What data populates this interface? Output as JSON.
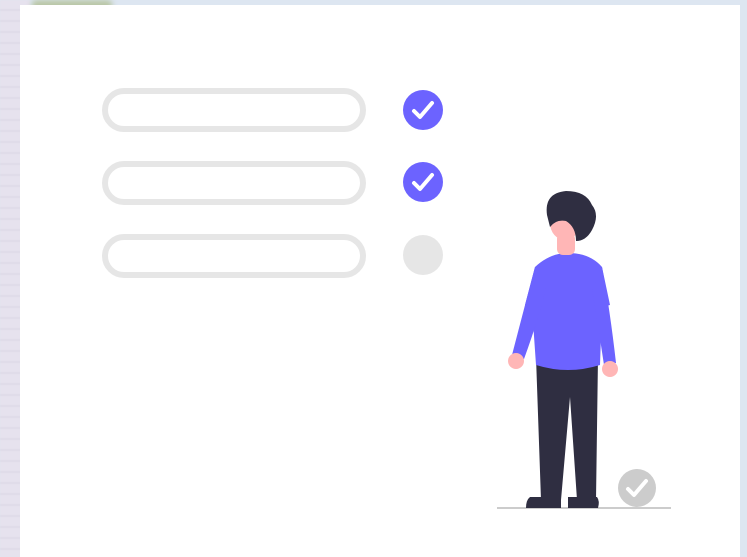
{
  "illustration": {
    "colors": {
      "accent": "#6c63ff",
      "inactive": "#e6e6e6",
      "hair": "#2f2e41",
      "skin": "#ffb6b6",
      "pants": "#2f2e41",
      "shoes": "#2f2e41",
      "ground": "#cccccc",
      "done_badge": "#cccccc"
    },
    "checklist": [
      {
        "status": "checked",
        "icon": "check-icon"
      },
      {
        "status": "checked",
        "icon": "check-icon"
      },
      {
        "status": "unchecked",
        "icon": ""
      }
    ],
    "person_icon": "person-standing",
    "completion_icon": "check-icon"
  }
}
